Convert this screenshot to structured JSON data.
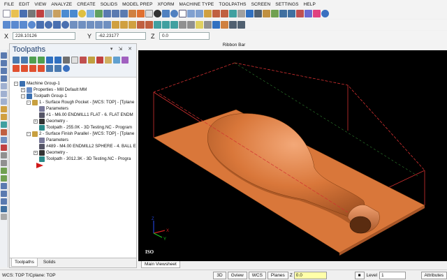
{
  "menu": [
    "FILE",
    "EDIT",
    "VIEW",
    "ANALYZE",
    "CREATE",
    "SOLIDS",
    "MODEL PREP",
    "XFORM",
    "MACHINE TYPE",
    "TOOLPATHS",
    "SCREEN",
    "SETTINGS",
    "HELP"
  ],
  "coords": {
    "x_label": "X",
    "x_value": "228.10126",
    "y_label": "Y",
    "y_value": "-62.23177",
    "z_label": "Z",
    "z_value": "0.0"
  },
  "ribbon_label": "Ribbon Bar",
  "panel": {
    "title": "Toolpaths",
    "controls": "▾ ⇲ ✕"
  },
  "tree": [
    {
      "text": "Machine Group-1",
      "color": "#3a6fb0"
    },
    {
      "text": "Properties - Mill Default MM",
      "color": "#6a8fc8"
    },
    {
      "text": "Toolpath Group-1",
      "color": "#3a6fb0"
    },
    {
      "text": "1 - Surface Rough Pocket - [WCS: TOP] - [Tplane",
      "color": "#c8a040"
    },
    {
      "text": "Parameters",
      "color": "#7a7a9a"
    },
    {
      "text": "#1 - M6.00 ENDMILL1 FLAT - 6. FLAT ENDM",
      "color": "#556"
    },
    {
      "text": "Geometry -",
      "color": "#333"
    },
    {
      "text": "Toolpath - 255.0K - 3D Testing.NC - Program",
      "color": "#2a8a8a"
    },
    {
      "text": "2 - Surface Finish Parallel - [WCS: TOP] - [Tplane",
      "color": "#c8a040"
    },
    {
      "text": "Parameters",
      "color": "#7a7a9a"
    },
    {
      "text": "#489 - M4.00 ENDMILL2 SPHERE - 4. BALL E",
      "color": "#556"
    },
    {
      "text": "Geometry -",
      "color": "#333"
    },
    {
      "text": "Toolpath - 3012.3K - 3D Testing.NC - Progra",
      "color": "#2a8a8a"
    }
  ],
  "panel_tabs": [
    "Toolpaths",
    "Solids"
  ],
  "viewport": {
    "view_label": "ISO",
    "tab": "Main Viewsheet",
    "axis_x": "X",
    "axis_y": "Y",
    "axis_z": "Z"
  },
  "status": {
    "wcs": "WCS: TOP  T/Cplane: TOP",
    "btn_3d": "3D",
    "btn_gview": "Gview",
    "btn_wcs": "WCS",
    "btn_planes": "Planes",
    "z_label": "Z",
    "z_value": "0.0",
    "level_label": "Level",
    "level_value": "1",
    "attributes": "Attributes"
  },
  "colors": {
    "part": "#d9773a",
    "viewport_bg": "#000000",
    "bbox": "#d23030"
  }
}
